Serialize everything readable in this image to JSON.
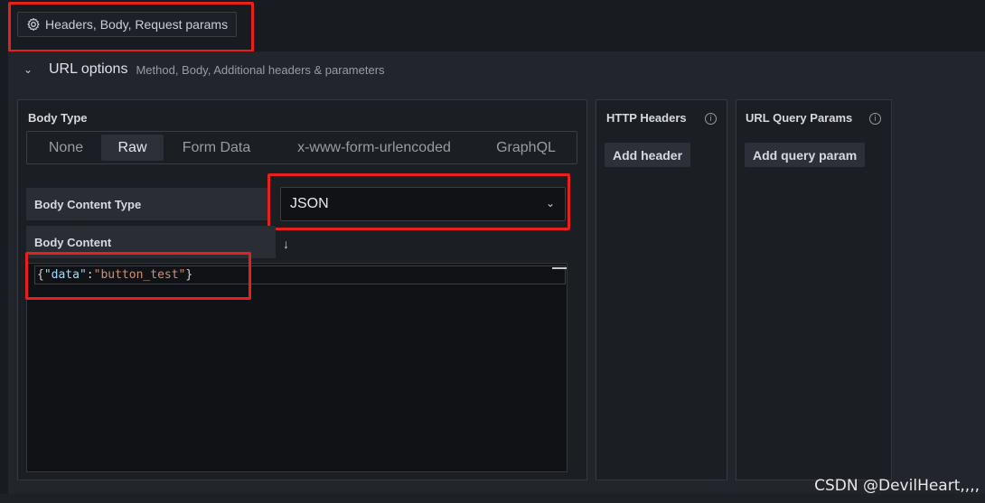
{
  "toggle_button": {
    "label": "Headers, Body, Request params",
    "icon": "gear-icon"
  },
  "url_options": {
    "title": "URL options",
    "description": "Method, Body, Additional headers & parameters"
  },
  "body": {
    "type_label": "Body Type",
    "types": [
      "None",
      "Raw",
      "Form Data",
      "x-www-form-urlencoded",
      "GraphQL"
    ],
    "selected_type": "Raw",
    "content_type_label": "Body Content Type",
    "content_type_value": "JSON",
    "content_label": "Body Content",
    "code": {
      "open": "{",
      "key": "\"data\"",
      "colon": ":",
      "value": "\"button_test\"",
      "close": "}"
    }
  },
  "http_headers": {
    "title": "HTTP Headers",
    "add_label": "Add header"
  },
  "query_params": {
    "title": "URL Query Params",
    "add_label": "Add query param"
  },
  "watermark": "CSDN @DevilHeart,,,,",
  "colors": {
    "highlight_box": "#e6201c",
    "key": "#9cdcfe",
    "string": "#ce9178"
  }
}
